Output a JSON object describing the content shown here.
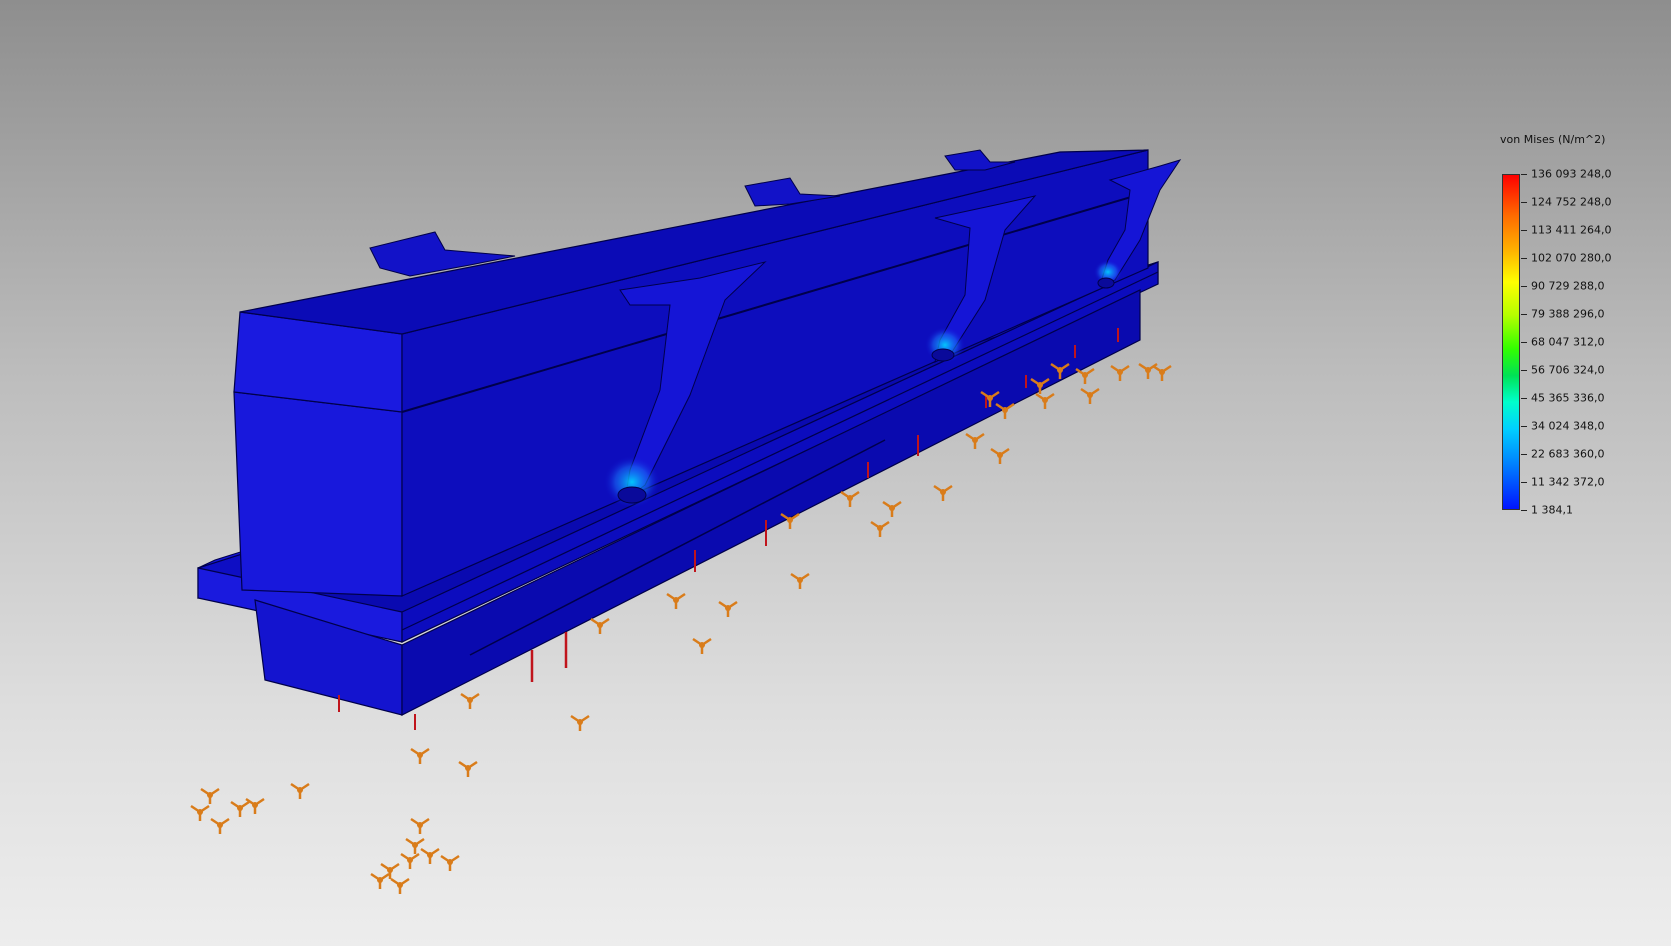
{
  "legend": {
    "title": "von Mises (N/m^2)",
    "values": [
      "136 093 248,0",
      "124 752 248,0",
      "113 411 264,0",
      "102 070 280,0",
      "90 729 288,0",
      "79 388 296,0",
      "68 047 312,0",
      "56 706 324,0",
      "45 365 336,0",
      "34 024 348,0",
      "22 683 360,0",
      "11 342 372,0",
      "1 384,1"
    ]
  },
  "colors": {
    "background_top": "#8e8e8e",
    "background_bottom": "#ededed",
    "model_primary": "#1010d2",
    "model_dark": "#0000a8",
    "fixture_arrow": "#d97c1a",
    "load_arrow": "#c0141c",
    "stress_max": "#ff0000",
    "stress_min": "#0014ff"
  }
}
